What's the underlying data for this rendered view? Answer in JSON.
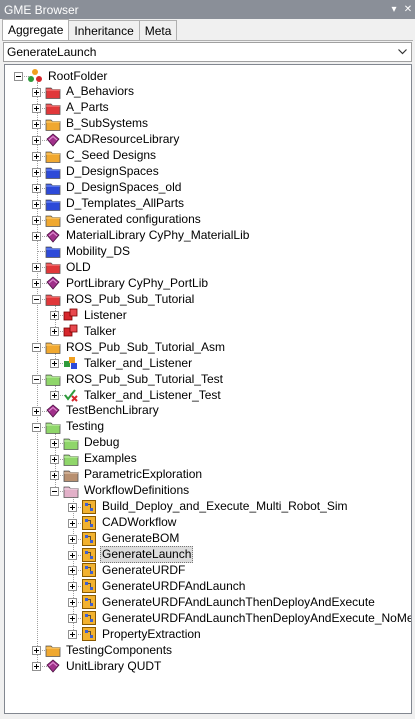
{
  "window": {
    "title": "GME Browser",
    "pin_glyph": "▾",
    "close_glyph": "✕"
  },
  "tabs": [
    {
      "label": "Aggregate",
      "active": true
    },
    {
      "label": "Inheritance",
      "active": false
    },
    {
      "label": "Meta",
      "active": false
    }
  ],
  "combo": {
    "value": "GenerateLaunch"
  },
  "tree": [
    {
      "label": "RootFolder",
      "level": 0,
      "icon": "root",
      "expanded": true,
      "hasChildren": true
    },
    {
      "label": "A_Behaviors",
      "level": 1,
      "icon": "folder-red",
      "hasChildren": true
    },
    {
      "label": "A_Parts",
      "level": 1,
      "icon": "folder-red",
      "hasChildren": true
    },
    {
      "label": "B_SubSystems",
      "level": 1,
      "icon": "folder-orange",
      "hasChildren": true
    },
    {
      "label": "CADResourceLibrary",
      "level": 1,
      "icon": "library",
      "hasChildren": true
    },
    {
      "label": "C_Seed Designs",
      "level": 1,
      "icon": "folder-orange",
      "hasChildren": true
    },
    {
      "label": "D_DesignSpaces",
      "level": 1,
      "icon": "folder-blue",
      "hasChildren": true
    },
    {
      "label": "D_DesignSpaces_old",
      "level": 1,
      "icon": "folder-blue",
      "hasChildren": true
    },
    {
      "label": "D_Templates_AllParts",
      "level": 1,
      "icon": "folder-blue",
      "hasChildren": true
    },
    {
      "label": "Generated configurations",
      "level": 1,
      "icon": "folder-orange",
      "hasChildren": true
    },
    {
      "label": "MaterialLibrary CyPhy_MaterialLib",
      "level": 1,
      "icon": "library",
      "hasChildren": true
    },
    {
      "label": "Mobility_DS",
      "level": 1,
      "icon": "folder-blue",
      "hasChildren": false
    },
    {
      "label": "OLD",
      "level": 1,
      "icon": "folder-red",
      "hasChildren": true
    },
    {
      "label": "PortLibrary CyPhy_PortLib",
      "level": 1,
      "icon": "library",
      "hasChildren": true
    },
    {
      "label": "ROS_Pub_Sub_Tutorial",
      "level": 1,
      "icon": "folder-red",
      "expanded": true,
      "hasChildren": true
    },
    {
      "label": "Listener",
      "level": 2,
      "icon": "component",
      "hasChildren": true
    },
    {
      "label": "Talker",
      "level": 2,
      "icon": "component",
      "hasChildren": true
    },
    {
      "label": "ROS_Pub_Sub_Tutorial_Asm",
      "level": 1,
      "icon": "folder-orange",
      "expanded": true,
      "hasChildren": true
    },
    {
      "label": "Talker_and_Listener",
      "level": 2,
      "icon": "assembly",
      "hasChildren": true
    },
    {
      "label": "ROS_Pub_Sub_Tutorial_Test",
      "level": 1,
      "icon": "folder-green",
      "expanded": true,
      "hasChildren": true
    },
    {
      "label": "Talker_and_Listener_Test",
      "level": 2,
      "icon": "testbench",
      "hasChildren": true
    },
    {
      "label": "TestBenchLibrary",
      "level": 1,
      "icon": "library",
      "hasChildren": true
    },
    {
      "label": "Testing",
      "level": 1,
      "icon": "folder-green",
      "expanded": true,
      "hasChildren": true
    },
    {
      "label": "Debug",
      "level": 2,
      "icon": "folder-green",
      "hasChildren": true
    },
    {
      "label": "Examples",
      "level": 2,
      "icon": "folder-green",
      "hasChildren": true
    },
    {
      "label": "ParametricExploration",
      "level": 2,
      "icon": "folder-brown",
      "hasChildren": true
    },
    {
      "label": "WorkflowDefinitions",
      "level": 2,
      "icon": "folder-pink",
      "expanded": true,
      "hasChildren": true
    },
    {
      "label": "Build_Deploy_and_Execute_Multi_Robot_Sim",
      "level": 3,
      "icon": "workflow",
      "hasChildren": true
    },
    {
      "label": "CADWorkflow",
      "level": 3,
      "icon": "workflow",
      "hasChildren": true
    },
    {
      "label": "GenerateBOM",
      "level": 3,
      "icon": "workflow",
      "hasChildren": true
    },
    {
      "label": "GenerateLaunch",
      "level": 3,
      "icon": "workflow",
      "hasChildren": true,
      "selected": true
    },
    {
      "label": "GenerateURDF",
      "level": 3,
      "icon": "workflow",
      "hasChildren": true
    },
    {
      "label": "GenerateURDFAndLaunch",
      "level": 3,
      "icon": "workflow",
      "hasChildren": true
    },
    {
      "label": "GenerateURDFAndLaunchThenDeployAndExecute",
      "level": 3,
      "icon": "workflow",
      "hasChildren": true
    },
    {
      "label": "GenerateURDFAndLaunchThenDeployAndExecute_NoMetrics",
      "level": 3,
      "icon": "workflow",
      "hasChildren": true
    },
    {
      "label": "PropertyExtraction",
      "level": 3,
      "icon": "workflow",
      "hasChildren": true
    },
    {
      "label": "TestingComponents",
      "level": 1,
      "icon": "folder-orange",
      "hasChildren": true
    },
    {
      "label": "UnitLibrary QUDT",
      "level": 1,
      "icon": "library",
      "hasChildren": true
    }
  ]
}
